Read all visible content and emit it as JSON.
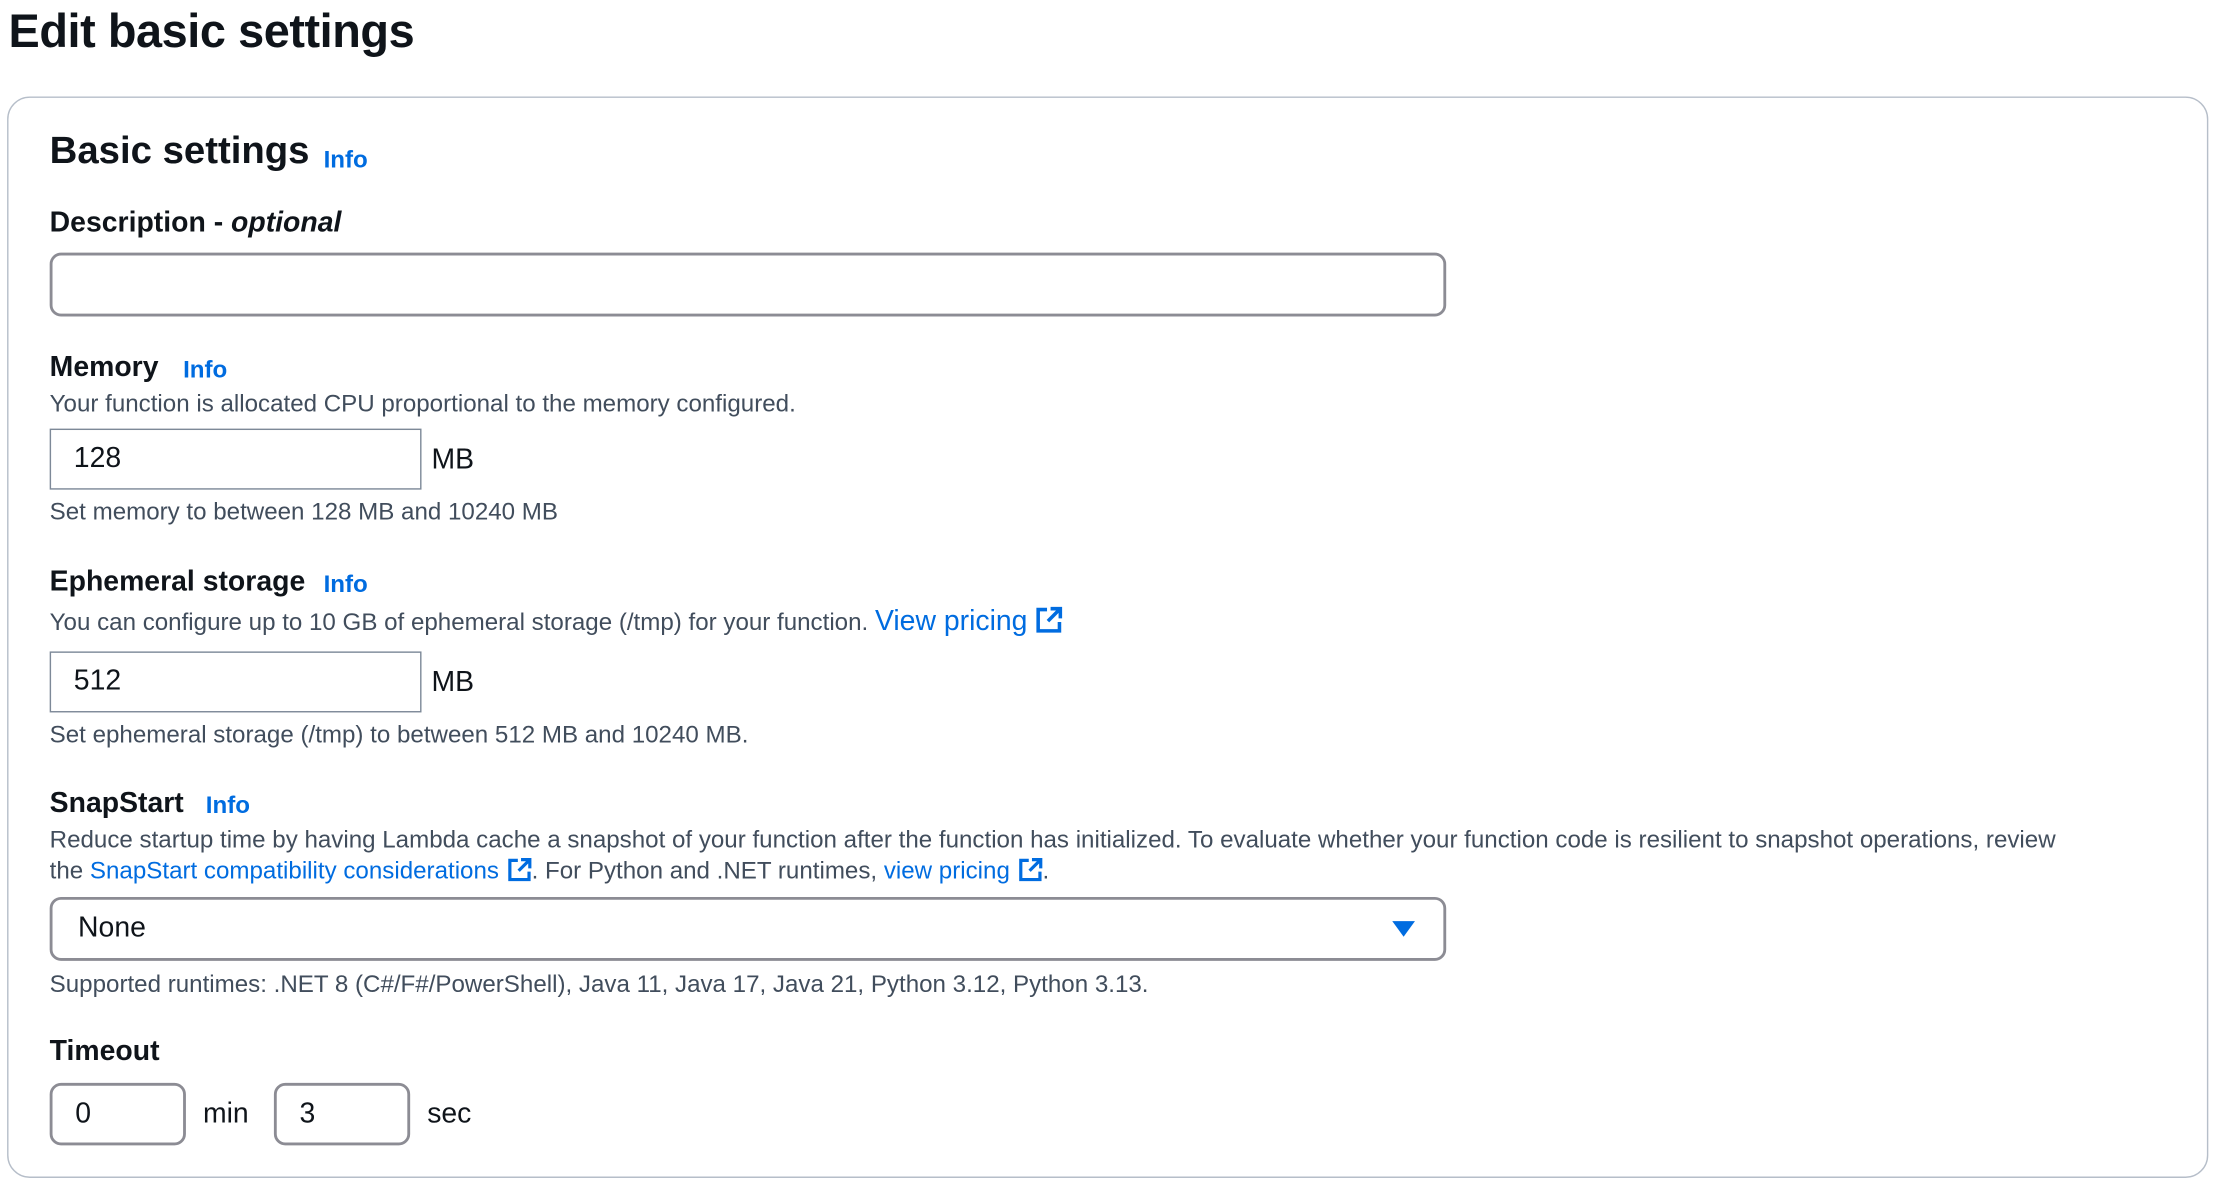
{
  "page": {
    "title": "Edit basic settings"
  },
  "basic": {
    "heading": "Basic settings",
    "info": "Info"
  },
  "description": {
    "label": "Description - ",
    "optional": "optional",
    "value": ""
  },
  "memory": {
    "label": "Memory",
    "info": "Info",
    "help": "Your function is allocated CPU proportional to the memory configured.",
    "value": "128",
    "unit": "MB",
    "constraint": "Set memory to between 128 MB and 10240 MB"
  },
  "ephemeral": {
    "label": "Ephemeral storage",
    "info": "Info",
    "help": "You can configure up to 10 GB of ephemeral storage (/tmp) for your function.",
    "link": "View pricing",
    "value": "512",
    "unit": "MB",
    "constraint": "Set ephemeral storage (/tmp) to between 512 MB and 10240 MB."
  },
  "snapstart": {
    "label": "SnapStart",
    "info": "Info",
    "help1": "Reduce startup time by having Lambda cache a snapshot of your function after the function has initialized. To evaluate whether your function code is resilient to snapshot operations, review",
    "help2_pre": "the ",
    "link1": "SnapStart compatibility considerations",
    "help2_mid": ". For Python and .NET runtimes, ",
    "link2": "view pricing",
    "help2_end": ".",
    "selected": "None",
    "runtimes": "Supported runtimes: .NET 8 (C#/F#/PowerShell), Java 11, Java 17, Java 21, Python 3.12, Python 3.13."
  },
  "timeout": {
    "label": "Timeout",
    "min_value": "0",
    "min_unit": "min",
    "sec_value": "3",
    "sec_unit": "sec"
  },
  "icons": {
    "external": "external-link-icon",
    "dropdown": "caret-down-icon"
  },
  "colors": {
    "link": "#006ce0",
    "text": "#0f141a",
    "muted": "#414d5c"
  }
}
